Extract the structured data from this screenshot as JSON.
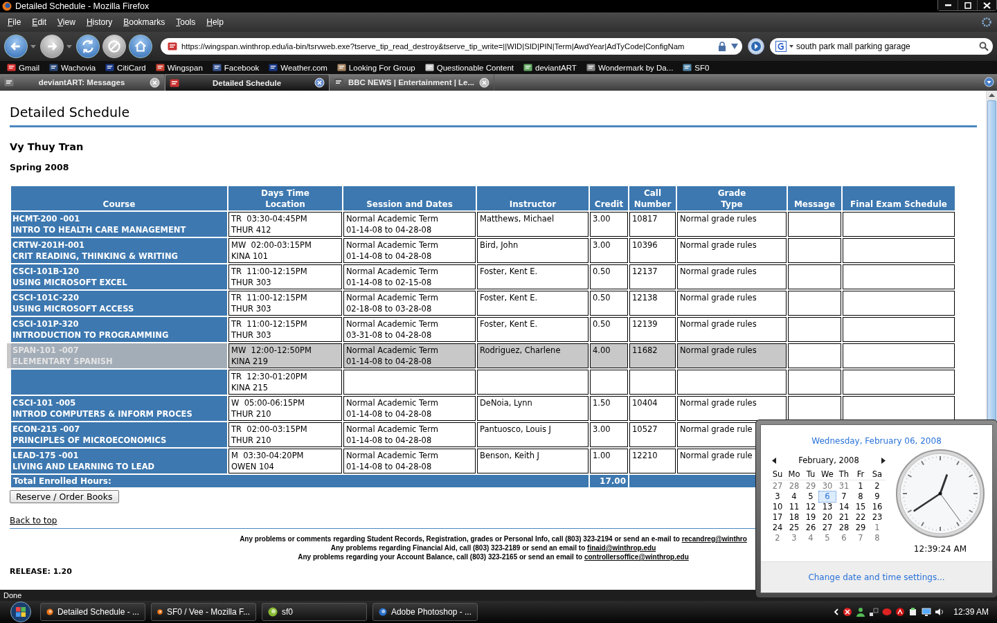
{
  "window": {
    "title": "Detailed Schedule - Mozilla Firefox"
  },
  "menu": [
    "File",
    "Edit",
    "View",
    "History",
    "Bookmarks",
    "Tools",
    "Help"
  ],
  "navigation": {
    "buttons": [
      {
        "kind": "back",
        "disabled": false
      },
      {
        "kind": "forward",
        "disabled": true
      },
      {
        "kind": "reload",
        "disabled": false
      },
      {
        "kind": "stop",
        "disabled": true
      },
      {
        "kind": "home",
        "disabled": false
      }
    ],
    "url": "https://wingspan.winthrop.edu/ia-bin/tsrvweb.exe?tserve_tip_read_destroy&tserve_tip_write=||WID|SID|PIN|Term|AwdYear|AdTyCode|ConfigNam",
    "search": "south park mall parking garage"
  },
  "bookmarks": [
    "Gmail",
    "Wachovia",
    "CitiCard",
    "Wingspan",
    "Facebook",
    "Weather.com",
    "Looking For Group",
    "Questionable Content",
    "deviantART",
    "Wondermark by Da...",
    "SF0"
  ],
  "tabs": [
    {
      "label": "deviantART: Messages",
      "selected": false
    },
    {
      "label": "Detailed Schedule",
      "selected": true
    },
    {
      "label": "BBC NEWS | Entertainment | Le...",
      "selected": false
    }
  ],
  "page": {
    "heading": "Detailed Schedule",
    "student": "Vy Thuy Tran",
    "term": "Spring 2008",
    "table": {
      "columns": [
        "Course",
        "Days Time\nLocation",
        "Session and Dates",
        "Instructor",
        "Credit",
        "Call\nNumber",
        "Grade\nType",
        "Message",
        "Final Exam Schedule"
      ],
      "rows": [
        {
          "course_code": "HCMT-200 -001",
          "course_title": "INTRO TO HEALTH CARE MANAGEMENT",
          "days_time": "TR  03:30-04:45PM",
          "location": "THUR 412",
          "session": "Normal Academic Term",
          "dates": "01-14-08 to 04-28-08",
          "instructor": "Matthews, Michael",
          "credit": "3.00",
          "call_number": "10817",
          "grade_type": "Normal grade rules",
          "highlighted": false
        },
        {
          "course_code": "CRTW-201H-001",
          "course_title": "CRIT READING, THINKING & WRITING",
          "days_time": "MW  02:00-03:15PM",
          "location": "KINA 101",
          "session": "Normal Academic Term",
          "dates": "01-14-08 to 04-28-08",
          "instructor": "Bird, John",
          "credit": "3.00",
          "call_number": "10396",
          "grade_type": "Normal grade rules",
          "highlighted": false
        },
        {
          "course_code": "CSCI-101B-120",
          "course_title": "USING MICROSOFT EXCEL",
          "days_time": "TR  11:00-12:15PM",
          "location": "THUR 303",
          "session": "Normal Academic Term",
          "dates": "01-14-08 to 02-15-08",
          "instructor": "Foster, Kent E.",
          "credit": "0.50",
          "call_number": "12137",
          "grade_type": "Normal grade rules",
          "highlighted": false
        },
        {
          "course_code": "CSCI-101C-220",
          "course_title": "USING MICROSOFT ACCESS",
          "days_time": "TR  11:00-12:15PM",
          "location": "THUR 303",
          "session": "Normal Academic Term",
          "dates": "02-18-08 to 03-28-08",
          "instructor": "Foster, Kent E.",
          "credit": "0.50",
          "call_number": "12138",
          "grade_type": "Normal grade rules",
          "highlighted": false
        },
        {
          "course_code": "CSCI-101P-320",
          "course_title": "INTRODUCTION TO PROGRAMMING",
          "days_time": "TR  11:00-12:15PM",
          "location": "THUR 303",
          "session": "Normal Academic Term",
          "dates": "03-31-08 to 04-28-08",
          "instructor": "Foster, Kent E.",
          "credit": "0.50",
          "call_number": "12139",
          "grade_type": "Normal grade rules",
          "highlighted": false
        },
        {
          "course_code": "SPAN-101 -007",
          "course_title": "ELEMENTARY SPANISH",
          "days_time": "MW  12:00-12:50PM",
          "location": "KINA 219",
          "session": "Normal Academic Term",
          "dates": "01-14-08 to 04-28-08",
          "instructor": "Rodriguez, Charlene",
          "credit": "4.00",
          "call_number": "11682",
          "grade_type": "Normal grade rules",
          "highlighted": true
        },
        {
          "days_time": "TR  12:30-01:20PM",
          "location": "KINA 215",
          "highlighted": false
        },
        {
          "course_code": "CSCI-101 -005",
          "course_title": "INTROD COMPUTERS & INFORM PROCES",
          "days_time": "W  05:00-06:15PM",
          "location": "THUR 210",
          "session": "Normal Academic Term",
          "dates": "01-14-08 to 04-28-08",
          "instructor": "DeNoia, Lynn",
          "credit": "1.50",
          "call_number": "10404",
          "grade_type": "Normal grade rules",
          "highlighted": false
        },
        {
          "course_code": "ECON-215 -007",
          "course_title": "PRINCIPLES OF MICROECONOMICS",
          "days_time": "TR  02:00-03:15PM",
          "location": "THUR 210",
          "session": "Normal Academic Term",
          "dates": "01-14-08 to 04-28-08",
          "instructor": "Pantuosco, Louis J",
          "credit": "3.00",
          "call_number": "10527",
          "grade_type": "Normal grade rule",
          "highlighted": false
        },
        {
          "course_code": "LEAD-175 -001",
          "course_title": "LIVING AND LEARNING TO LEAD",
          "days_time": "M  03:30-04:20PM",
          "location": "OWEN 104",
          "session": "Normal Academic Term",
          "dates": "01-14-08 to 04-28-08",
          "instructor": "Benson, Keith J",
          "credit": "1.00",
          "call_number": "12210",
          "grade_type": "Normal grade rule",
          "highlighted": false
        }
      ],
      "total_label": "Total Enrolled Hours:",
      "total_value": "17.00"
    },
    "reserve_button": "Reserve / Order Books",
    "back_to_top": "Back to top",
    "footer": [
      {
        "text": "Any problems or comments regarding Student Records, Registration, grades or Personal Info, call (803) 323-2194 or send an e-mail to",
        "link": "recandreg@winthro"
      },
      {
        "text": "Any problems regarding Financial Aid, call (803) 323-2189 or send an email to",
        "link": "finaid@winthrop.edu"
      },
      {
        "text": "Any problems regarding your Account Balance, call (803) 323-2165 or send an email to",
        "link": "controllersoffice@winthrop.edu"
      }
    ],
    "release": "RELEASE: 1.20"
  },
  "status_bar": "Done",
  "taskbar": {
    "buttons": [
      "Detailed Schedule - ...",
      "SF0 / Vee - Mozilla F...",
      "sf0",
      "Adobe Photoshop - ..."
    ],
    "clock": "12:39 AM"
  },
  "clock_popup": {
    "date": "Wednesday, February 06, 2008",
    "month": "February, 2008",
    "weekdays": [
      "Su",
      "Mo",
      "Tu",
      "We",
      "Th",
      "Fr",
      "Sa"
    ],
    "weeks": [
      [
        {
          "day": "27",
          "other_month": true,
          "selected": false
        },
        {
          "day": "28",
          "other_month": true,
          "selected": false
        },
        {
          "day": "29",
          "other_month": true,
          "selected": false
        },
        {
          "day": "30",
          "other_month": true,
          "selected": false
        },
        {
          "day": "31",
          "other_month": true,
          "selected": false
        },
        {
          "day": "1",
          "other_month": false,
          "selected": false
        },
        {
          "day": "2",
          "other_month": false,
          "selected": false
        }
      ],
      [
        {
          "day": "3",
          "other_month": false,
          "selected": false
        },
        {
          "day": "4",
          "other_month": false,
          "selected": false
        },
        {
          "day": "5",
          "other_month": false,
          "selected": false
        },
        {
          "day": "6",
          "other_month": false,
          "selected": true
        },
        {
          "day": "7",
          "other_month": false,
          "selected": false
        },
        {
          "day": "8",
          "other_month": false,
          "selected": false
        },
        {
          "day": "9",
          "other_month": false,
          "selected": false
        }
      ],
      [
        {
          "day": "10",
          "other_month": false,
          "selected": false
        },
        {
          "day": "11",
          "other_month": false,
          "selected": false
        },
        {
          "day": "12",
          "other_month": false,
          "selected": false
        },
        {
          "day": "13",
          "other_month": false,
          "selected": false
        },
        {
          "day": "14",
          "other_month": false,
          "selected": false
        },
        {
          "day": "15",
          "other_month": false,
          "selected": false
        },
        {
          "day": "16",
          "other_month": false,
          "selected": false
        }
      ],
      [
        {
          "day": "17",
          "other_month": false,
          "selected": false
        },
        {
          "day": "18",
          "other_month": false,
          "selected": false
        },
        {
          "day": "19",
          "other_month": false,
          "selected": false
        },
        {
          "day": "20",
          "other_month": false,
          "selected": false
        },
        {
          "day": "21",
          "other_month": false,
          "selected": false
        },
        {
          "day": "22",
          "other_month": false,
          "selected": false
        },
        {
          "day": "23",
          "other_month": false,
          "selected": false
        }
      ],
      [
        {
          "day": "24",
          "other_month": false,
          "selected": false
        },
        {
          "day": "25",
          "other_month": false,
          "selected": false
        },
        {
          "day": "26",
          "other_month": false,
          "selected": false
        },
        {
          "day": "27",
          "other_month": false,
          "selected": false
        },
        {
          "day": "28",
          "other_month": false,
          "selected": false
        },
        {
          "day": "29",
          "other_month": false,
          "selected": false
        },
        {
          "day": "1",
          "other_month": true,
          "selected": false
        }
      ],
      [
        {
          "day": "2",
          "other_month": true,
          "selected": false
        },
        {
          "day": "3",
          "other_month": true,
          "selected": false
        },
        {
          "day": "4",
          "other_month": true,
          "selected": false
        },
        {
          "day": "5",
          "other_month": true,
          "selected": false
        },
        {
          "day": "6",
          "other_month": true,
          "selected": false
        },
        {
          "day": "7",
          "other_month": true,
          "selected": false
        },
        {
          "day": "8",
          "other_month": true,
          "selected": false
        }
      ]
    ],
    "time": "12:39:24 AM",
    "settings_link": "Change date and time settings..."
  }
}
